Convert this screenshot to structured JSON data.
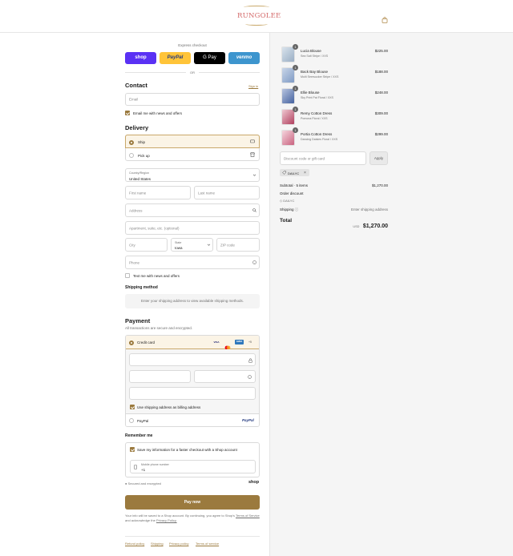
{
  "brand": {
    "name": "RUNGOLEE"
  },
  "express": {
    "title": "Express checkout",
    "shop_label": "shop",
    "paypal_label": "PayPal",
    "gpay_label": "G Pay",
    "venmo_label": "venmo",
    "or_label": "OR"
  },
  "contact": {
    "title": "Contact",
    "signin_label": "Sign in",
    "email_placeholder": "Email",
    "news_label": "Email me with news and offers"
  },
  "delivery": {
    "title": "Delivery",
    "ship_label": "Ship",
    "pickup_label": "Pick up",
    "country_label": "Country/Region",
    "country_value": "United States",
    "first_name_placeholder": "First name",
    "last_name_placeholder": "Last name",
    "address_placeholder": "Address",
    "apartment_placeholder": "Apartment, suite, etc. (optional)",
    "city_placeholder": "City",
    "state_label": "State",
    "state_value": "Iowa",
    "zip_placeholder": "ZIP code",
    "phone_placeholder": "Phone",
    "text_news_label": "Text me with news and offers"
  },
  "shipping_method": {
    "title": "Shipping method",
    "info": "Enter your shipping address to view available shipping methods."
  },
  "payment": {
    "title": "Payment",
    "subtitle": "All transactions are secure and encrypted.",
    "credit_card_label": "Credit card",
    "card_brands": [
      "VISA",
      "MC",
      "AMEX",
      "+5"
    ],
    "billing_label": "Use shipping address as billing address",
    "paypal_label": "PayPal",
    "paypal_logo": "PayPal"
  },
  "remember": {
    "title": "Remember me",
    "save_label": "Save my information for a faster checkout with a Shop account",
    "mobile_label": "Mobile phone number",
    "mobile_value": "+1",
    "secure_label": "Secured and encrypted",
    "shop_label": "shop"
  },
  "pay_now_label": "Pay now",
  "disclaimer": {
    "text": "Your info will be saved to a Shop account. By continuing, you agree to Shop's",
    "terms": "Terms of Service",
    "and": "and acknowledge the",
    "privacy": "Privacy Policy."
  },
  "footer_links": [
    "Refund policy",
    "Shipping",
    "Privacy policy",
    "Terms of service"
  ],
  "cart": {
    "items": [
      {
        "name": "Lucia Blouse",
        "variant": "Sea Salt Stripe / XXS",
        "price": "$225.00",
        "qty": "1",
        "color": "#c9d3dd"
      },
      {
        "name": "Back Bay Blouse",
        "variant": "Multi Seersucker Stripe / XXS",
        "price": "$188.00",
        "qty": "1",
        "color": "#9fb4d0"
      },
      {
        "name": "Ellie Blouse",
        "variant": "Sky Print Pat Floral / XXS",
        "price": "$248.00",
        "qty": "1",
        "color": "#6f86b8"
      },
      {
        "name": "Remy Cotton Dress",
        "variant": "Pomona Floral / XXS",
        "price": "$309.00",
        "qty": "1",
        "color": "#c86a82"
      },
      {
        "name": "Portia Cotton Dress",
        "variant": "Dancing Daisies Floral / XXS",
        "price": "$299.00",
        "qty": "1",
        "color": "#d98aa0"
      }
    ],
    "discount_placeholder": "Discount code or gift card",
    "apply_label": "Apply",
    "code_tag": "DAILYC",
    "subtotal_label": "Subtotal · 5 items",
    "subtotal_value": "$1,270.00",
    "order_discount_label": "Order discount",
    "order_discount_code": "DAILYC",
    "shipping_label": "Shipping",
    "shipping_value": "Enter shipping address",
    "total_label": "Total",
    "currency": "USD",
    "total_value": "$1,270.00"
  },
  "colors": {
    "accent": "#9b7a3e",
    "shop": "#5a31f4",
    "paypal": "#ffc439",
    "venmo": "#3d95ce"
  }
}
